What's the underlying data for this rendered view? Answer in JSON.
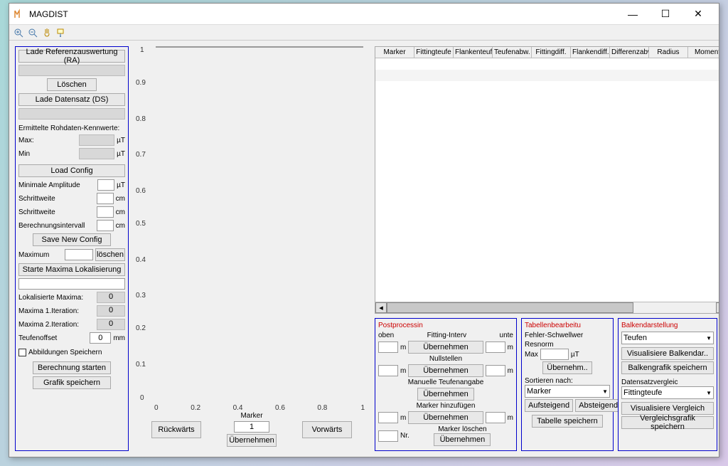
{
  "window": {
    "title": "MAGDIST"
  },
  "left": {
    "load_ra": "Lade Referenzauswertung (RA)",
    "delete": "Löschen",
    "load_ds": "Lade Datensatz (DS)",
    "rawlabel": "Ermittelte Rohdaten-Kennwerte:",
    "max": "Max:",
    "min": "Min",
    "ut": "µT",
    "load_config": "Load Config",
    "min_amp": "Minimale Amplitude",
    "schritt1": "Schrittweite",
    "schritt2": "Schrittweite",
    "berechint": "Berechnungsintervall",
    "cm": "cm",
    "save_config": "Save New Config",
    "maximum": "Maximum",
    "loeschen": "löschen",
    "start_maxima": "Starte Maxima Lokalisierung",
    "lok_maxima": "Lokalisierte Maxima:",
    "max_it1": "Maxima 1.Iteration:",
    "max_it2": "Maxima 2.Iteration:",
    "v0": "0",
    "teufenoffset": "Teufenoffset",
    "teufenoffset_val": "0",
    "mm": "mm",
    "abb_speichern": "Abbildungen Speichern",
    "berechnung_start": "Berechnung starten",
    "grafik_speichern": "Grafik speichern"
  },
  "mid": {
    "marker_label": "Marker",
    "marker_val": "1",
    "back": "Rückwärts",
    "forward": "Vorwärts",
    "take": "Übernehmen"
  },
  "chart_data": {
    "type": "scatter",
    "x": [],
    "y": [],
    "xlim": [
      0,
      1
    ],
    "ylim": [
      0,
      1
    ],
    "xticks": [
      0,
      0.2,
      0.4,
      0.6,
      0.8,
      1
    ],
    "yticks": [
      0,
      0.1,
      0.2,
      0.3,
      0.4,
      0.5,
      0.6,
      0.7,
      0.8,
      0.9,
      1
    ],
    "title": "",
    "xlabel": "",
    "ylabel": ""
  },
  "table": {
    "columns": [
      "Marker",
      "Fittingteufe",
      "Flankenteufe",
      "Teufenabw.",
      "Fittingdiff.",
      "Flankendiff.",
      "Differenzabw.",
      "Radius",
      "Moment"
    ],
    "rows": []
  },
  "pp": {
    "title": "Postprocessin",
    "oben": "oben",
    "unte": "unte",
    "fitting_interv": "Fitting-Interv",
    "uebernehmen": "Übernehmen",
    "nullstellen": "Nullstellen",
    "man_teufe": "Manuelle Teufenangabe",
    "marker_add": "Marker hinzufügen",
    "marker_del": "Marker löschen",
    "m": "m",
    "nr": "Nr."
  },
  "tab": {
    "title": "Tabellenbearbeitu",
    "fehler": "Fehler-Schwellwer",
    "resnorm": "Resnorm",
    "max": "Max",
    "ut": "µT",
    "ueb": "Übernehm..",
    "sort": "Sortieren nach:",
    "sort_sel": "Marker",
    "auf": "Aufsteigend",
    "ab": "Absteigend",
    "tabsave": "Tabelle speichern"
  },
  "balk": {
    "title": "Balkendarstellung",
    "sel1": "Teufen",
    "vis_bar": "Visualisiere Balkendar..",
    "bargrafik": "Balkengrafik speichern",
    "dsv": "Datensatzvergleic",
    "sel2": "Fittingteufe",
    "vis_verg": "Visualisiere Vergleich",
    "verg_save": "Vergleichsgrafik speichern"
  }
}
